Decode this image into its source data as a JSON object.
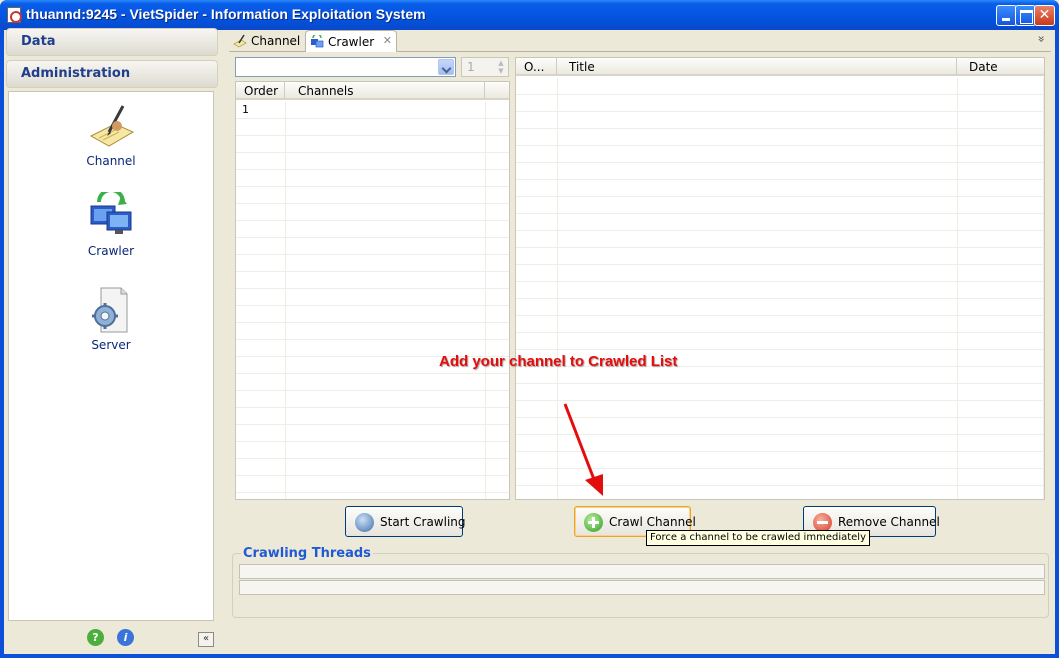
{
  "window": {
    "title": "thuannd:9245 - VietSpider - Information Exploitation System"
  },
  "nav": {
    "headers": [
      "Data",
      "Administration"
    ],
    "items": [
      {
        "label": "Channel",
        "icon": "channel-icon"
      },
      {
        "label": "Crawler",
        "icon": "crawler-icon"
      },
      {
        "label": "Server",
        "icon": "server-icon"
      }
    ],
    "collapse": "«"
  },
  "tabs": [
    {
      "label": "Channel",
      "icon": "channel-tab-icon"
    },
    {
      "label": "Crawler",
      "icon": "crawler-tab-icon",
      "active": true
    }
  ],
  "tab_close": "✕",
  "chevron": "»",
  "toolbar": {
    "combo_value": "",
    "spinner_value": "1"
  },
  "left_table": {
    "columns": [
      "Order",
      "Channels"
    ],
    "rows": [
      {
        "order": "1",
        "channel": ""
      }
    ]
  },
  "right_table": {
    "columns": [
      "O...",
      "Title",
      "Date"
    ],
    "rows": []
  },
  "annotation": "Add your channel to Crawled List",
  "buttons": {
    "start": "Start Crawling",
    "crawl": "Crawl Channel",
    "remove": "Remove Channel"
  },
  "tooltip": "Force a channel to be crawled immediately",
  "threads": {
    "title": "Crawling Threads"
  },
  "colors": {
    "annotation": "#e40d0d",
    "accent": "#1f5ad4",
    "titlebar": "#0555e2"
  }
}
